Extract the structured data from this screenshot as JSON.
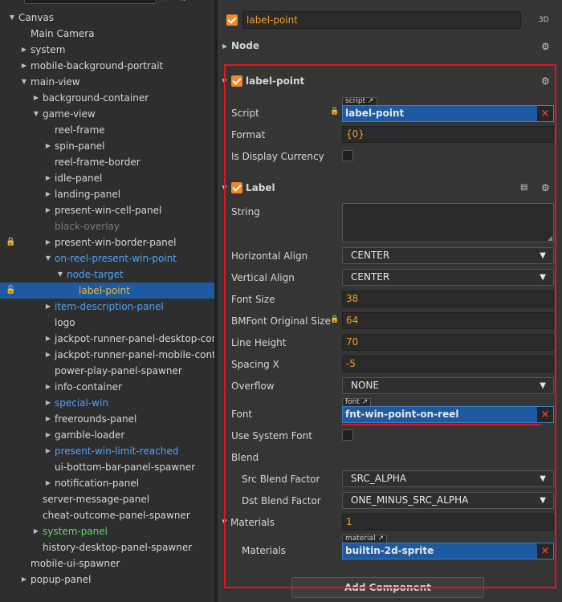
{
  "hierarchy": {
    "rows": [
      {
        "label": "Canvas",
        "indent": 0,
        "arrow": "down",
        "style": "normal"
      },
      {
        "label": "Main Camera",
        "indent": 1,
        "arrow": "none",
        "style": "normal"
      },
      {
        "label": "system",
        "indent": 1,
        "arrow": "right",
        "style": "normal"
      },
      {
        "label": "mobile-background-portrait",
        "indent": 1,
        "arrow": "right",
        "style": "normal"
      },
      {
        "label": "main-view",
        "indent": 1,
        "arrow": "down",
        "style": "normal"
      },
      {
        "label": "background-container",
        "indent": 2,
        "arrow": "right",
        "style": "normal"
      },
      {
        "label": "game-view",
        "indent": 2,
        "arrow": "down",
        "style": "normal"
      },
      {
        "label": "reel-frame",
        "indent": 3,
        "arrow": "none",
        "style": "normal"
      },
      {
        "label": "spin-panel",
        "indent": 3,
        "arrow": "right",
        "style": "normal"
      },
      {
        "label": "reel-frame-border",
        "indent": 3,
        "arrow": "none",
        "style": "normal"
      },
      {
        "label": "idle-panel",
        "indent": 3,
        "arrow": "right",
        "style": "normal"
      },
      {
        "label": "landing-panel",
        "indent": 3,
        "arrow": "right",
        "style": "normal"
      },
      {
        "label": "present-win-cell-panel",
        "indent": 3,
        "arrow": "right",
        "style": "normal"
      },
      {
        "label": "black-overlay",
        "indent": 3,
        "arrow": "none",
        "style": "gray"
      },
      {
        "label": "present-win-border-panel",
        "indent": 3,
        "arrow": "right",
        "style": "normal",
        "lock": "red"
      },
      {
        "label": "on-reel-present-win-point",
        "indent": 3,
        "arrow": "down",
        "style": "blue"
      },
      {
        "label": "node-target",
        "indent": 4,
        "arrow": "down",
        "style": "blue"
      },
      {
        "label": "label-point",
        "indent": 5,
        "arrow": "none",
        "style": "selected",
        "lock": "white"
      },
      {
        "label": "item-description-panel",
        "indent": 3,
        "arrow": "right",
        "style": "blue"
      },
      {
        "label": "logo",
        "indent": 3,
        "arrow": "none",
        "style": "normal"
      },
      {
        "label": "jackpot-runner-panel-desktop-cont",
        "indent": 3,
        "arrow": "right",
        "style": "normal"
      },
      {
        "label": "jackpot-runner-panel-mobile-conta",
        "indent": 3,
        "arrow": "right",
        "style": "normal"
      },
      {
        "label": "power-play-panel-spawner",
        "indent": 3,
        "arrow": "none",
        "style": "normal"
      },
      {
        "label": "info-container",
        "indent": 3,
        "arrow": "right",
        "style": "normal"
      },
      {
        "label": "special-win",
        "indent": 3,
        "arrow": "right",
        "style": "blue"
      },
      {
        "label": "freerounds-panel",
        "indent": 3,
        "arrow": "right",
        "style": "normal"
      },
      {
        "label": "gamble-loader",
        "indent": 3,
        "arrow": "right",
        "style": "normal"
      },
      {
        "label": "present-win-limit-reached",
        "indent": 3,
        "arrow": "right",
        "style": "blue"
      },
      {
        "label": "ui-bottom-bar-panel-spawner",
        "indent": 3,
        "arrow": "none",
        "style": "normal"
      },
      {
        "label": "notification-panel",
        "indent": 3,
        "arrow": "right",
        "style": "normal"
      },
      {
        "label": "server-message-panel",
        "indent": 2,
        "arrow": "none",
        "style": "normal"
      },
      {
        "label": "cheat-outcome-panel-spawner",
        "indent": 2,
        "arrow": "none",
        "style": "normal"
      },
      {
        "label": "system-panel",
        "indent": 2,
        "arrow": "right",
        "style": "green"
      },
      {
        "label": "history-desktop-panel-spawner",
        "indent": 2,
        "arrow": "none",
        "style": "normal"
      },
      {
        "label": "mobile-ui-spawner",
        "indent": 1,
        "arrow": "none",
        "style": "normal"
      },
      {
        "label": "popup-panel",
        "indent": 1,
        "arrow": "right",
        "style": "normal"
      }
    ]
  },
  "inspector": {
    "node_name": "label-point",
    "badge_3d": "3D",
    "node_section": "Node",
    "component1": {
      "title": "label-point",
      "script_tag": "script",
      "script_label": "Script",
      "script_value": "label-point",
      "format_label": "Format",
      "format_value": "{0}",
      "display_currency_label": "Is Display Currency"
    },
    "component2": {
      "title": "Label",
      "string_label": "String",
      "string_value": "",
      "halign_label": "Horizontal Align",
      "halign_value": "CENTER",
      "valign_label": "Vertical Align",
      "valign_value": "CENTER",
      "font_size_label": "Font Size",
      "font_size_value": "38",
      "bmfont_label": "BMFont Original Size",
      "bmfont_value": "64",
      "line_height_label": "Line Height",
      "line_height_value": "70",
      "spacing_label": "Spacing X",
      "spacing_value": "-5",
      "overflow_label": "Overflow",
      "overflow_value": "NONE",
      "font_tag": "font",
      "font_label": "Font",
      "font_value": "fnt-win-point-on-reel",
      "system_font_label": "Use System Font",
      "blend_label": "Blend",
      "src_blend_label": "Src Blend Factor",
      "src_blend_value": "SRC_ALPHA",
      "dst_blend_label": "Dst Blend Factor",
      "dst_blend_value": "ONE_MINUS_SRC_ALPHA",
      "materials_label": "Materials",
      "materials_count": "1",
      "material_tag": "material",
      "material_item_label": "Materials",
      "material_value": "builtin-2d-sprite"
    },
    "add_component": "Add Component"
  },
  "colors": {
    "highlight_red": "#e8141a",
    "asset_blue": "#1e5aa0",
    "value_orange": "#f0a030",
    "checkbox_orange": "#f08a24",
    "tree_blue": "#4aa3ff",
    "tree_green": "#6ad36a"
  }
}
